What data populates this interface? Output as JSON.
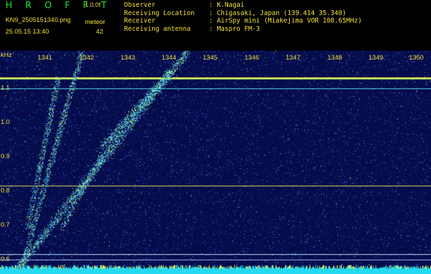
{
  "header": {
    "app_title": "H R O F F T",
    "version": "1.0.0f",
    "filename": "KN9_2505151340.png",
    "meteor_label": "meteor",
    "datetime": "25.05.15 13:40",
    "meteor_count": "42"
  },
  "station": {
    "rows": [
      {
        "key": "Observer",
        "value": ": K.Nagai"
      },
      {
        "key": "Receiving Location",
        "value": ": Chigasaki, Japan (139.414 35.340)"
      },
      {
        "key": "Receiver",
        "value": ": AirSpy mini (Miakejima VOR 108.65MHz)"
      },
      {
        "key": "Receiving antenna",
        "value": ": Maspro FM-3"
      }
    ]
  },
  "spectrogram": {
    "y_unit": "kHz",
    "x_ticks": [
      "1341",
      "1342",
      "1343",
      "1344",
      "1345",
      "1346",
      "1347",
      "1348",
      "1349",
      "1350"
    ],
    "y_ticks": [
      "1.1",
      "1.0",
      "0.9",
      "0.8",
      "0.7",
      "0.6"
    ],
    "colors": {
      "background": "#0a1470",
      "noise": "#3a8fe8",
      "signal": "#ffff40",
      "baseline": "#2ee6ff"
    }
  }
}
